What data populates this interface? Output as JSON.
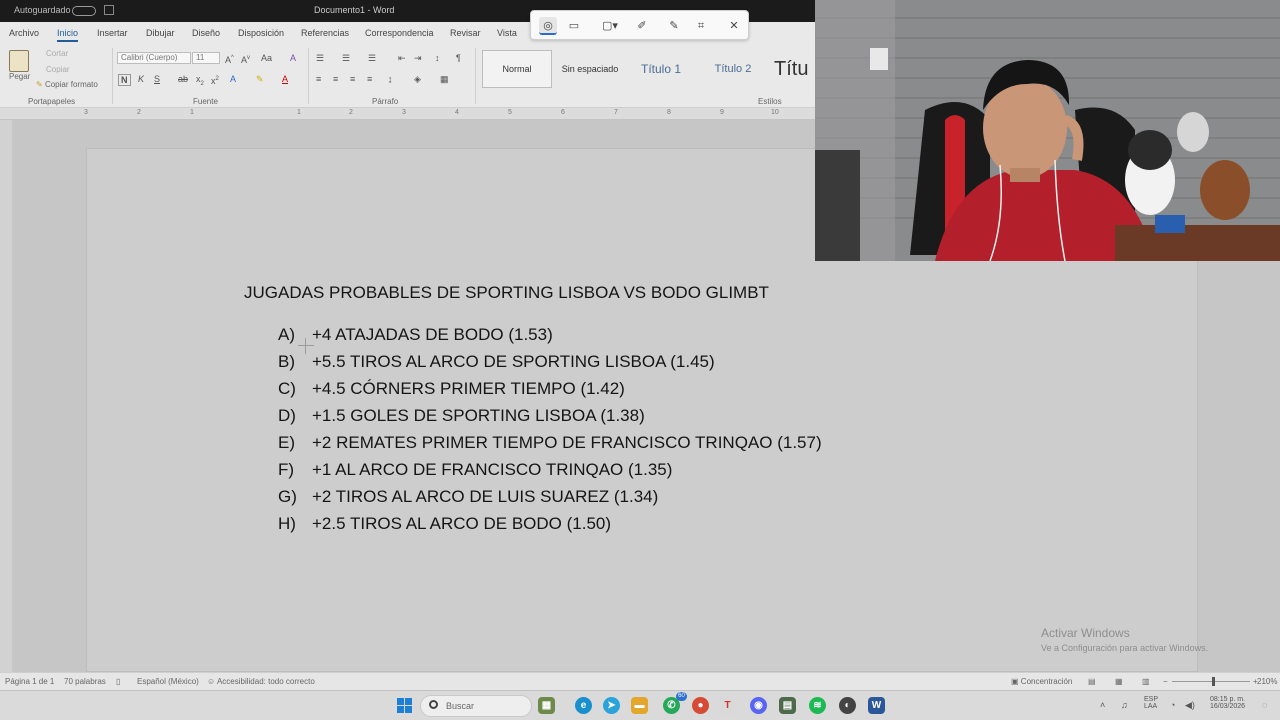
{
  "titlebar": {
    "autosave": "Autoguardado",
    "doc_title": "Documento1 - Word"
  },
  "tabs": [
    "Archivo",
    "Inicio",
    "Insertar",
    "Dibujar",
    "Diseño",
    "Disposición",
    "Referencias",
    "Correspondencia",
    "Revisar",
    "Vista"
  ],
  "ribbon": {
    "clipboard": {
      "paste": "Pegar",
      "cut": "Cortar",
      "copy": "Copiar",
      "format_painter": "Copiar formato",
      "label": "Portapapeles"
    },
    "font": {
      "name": "Calibri (Cuerpo)",
      "size": "11",
      "label": "Fuente"
    },
    "paragraph": {
      "label": "Párrafo"
    },
    "styles": {
      "normal": "Normal",
      "no_spacing": "Sin espaciado",
      "heading1": "Título 1",
      "heading2": "Título 2",
      "title": "Títu",
      "label": "Estilos"
    }
  },
  "ruler_numbers": [
    "3",
    "2",
    "1",
    "1",
    "2",
    "3",
    "4",
    "5",
    "6",
    "7",
    "8",
    "9",
    "10"
  ],
  "document": {
    "title": "JUGADAS PROBABLES DE SPORTING LISBOA VS BODO GLIMBT",
    "items": [
      {
        "letter": "A)",
        "text": "+4 ATAJADAS DE BODO (1.53)"
      },
      {
        "letter": "B)",
        "text": "+5.5 TIROS AL ARCO DE SPORTING LISBOA (1.45)"
      },
      {
        "letter": "C)",
        "text": "+4.5 CÓRNERS PRIMER TIEMPO (1.42)"
      },
      {
        "letter": "D)",
        "text": "+1.5 GOLES DE SPORTING LISBOA (1.38)"
      },
      {
        "letter": "E)",
        "text": "+2 REMATES PRIMER TIEMPO DE FRANCISCO TRINQAO (1.57)"
      },
      {
        "letter": "F)",
        "text": "+1 AL ARCO DE FRANCISCO TRINQAO (1.35)"
      },
      {
        "letter": "G)",
        "text": "+2 TIROS AL ARCO DE LUIS SUAREZ (1.34)"
      },
      {
        "letter": "H)",
        "text": "+2.5 TIROS AL ARCO DE BODO (1.50)"
      }
    ]
  },
  "activation": {
    "title": "Activar Windows",
    "subtitle": "Ve a Configuración para activar Windows."
  },
  "statusbar": {
    "page": "Página 1 de 1",
    "words": "70 palabras",
    "language": "Español (México)",
    "accessibility": "Accesibilidad: todo correcto",
    "focus": "Concentración",
    "zoom": "210%"
  },
  "taskbar": {
    "search_placeholder": "Buscar",
    "whatsapp_badge": "60",
    "lang_top": "ESP",
    "lang_bottom": "LAA",
    "time": "08:15 p. m.",
    "date": "16/03/2026"
  },
  "colors": {
    "word_blue": "#1f5d9b",
    "windows_blue": "#1e7fd6",
    "jersey_red": "#b3202c"
  }
}
